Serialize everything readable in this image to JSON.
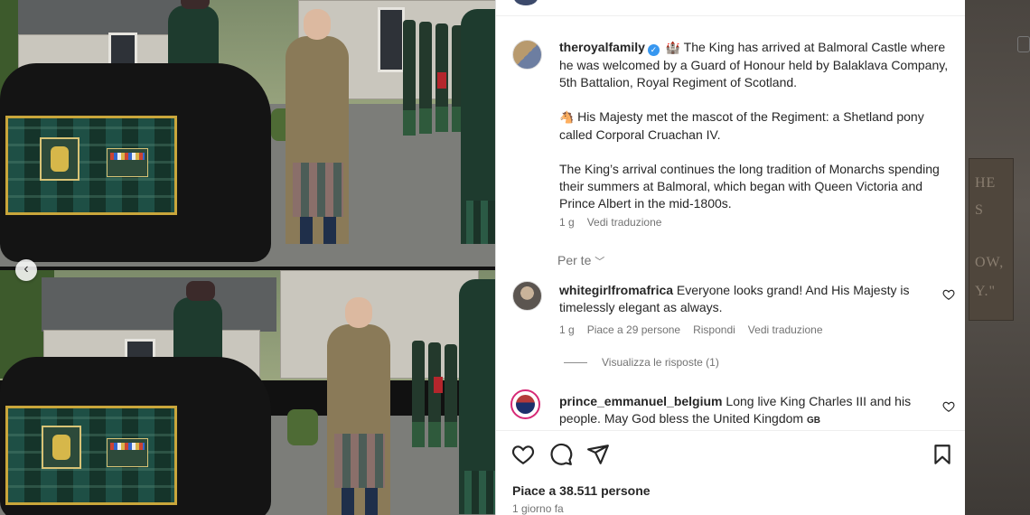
{
  "post": {
    "author": "theroyalfamily",
    "caption_p1": "The King has arrived at Balmoral Castle where he was welcomed by a Guard of Honour held by Balaklava Company, 5th Battalion, Royal Regiment of Scotland.",
    "caption_p2": "His Majesty met the mascot of the Regiment: a Shetland pony called Corporal Cruachan IV.",
    "caption_p3": "The King’s arrival continues the long tradition of Monarchs spending their summers at Balmoral, which began with Queen Victoria and Prince Albert in the mid-1800s.",
    "emoji1": "🏰",
    "emoji2": "🐴",
    "age": "1 g",
    "see_translation": "Vedi traduzione",
    "for_you": "Per te",
    "likes": "Piace a 38.511 persone",
    "time_ago": "1 giorno fa"
  },
  "comments": [
    {
      "username": "whitegirlfromafrica",
      "text": "Everyone looks grand! And His Majesty is timelessly elegant as always.",
      "age": "1 g",
      "likes": "Piace a 29 persone",
      "reply": "Rispondi",
      "translate": "Vedi traduzione",
      "view_replies": "Visualizza le risposte (1)"
    },
    {
      "username": "prince_emmanuel_belgium",
      "text": "Long live King Charles III and his people. May God bless the United Kingdom",
      "flag": "GB"
    }
  ],
  "icons": {
    "like": "heart-icon",
    "comment": "comment-icon",
    "share": "share-icon",
    "save": "bookmark-icon",
    "carousel": "chevron-left-icon",
    "verified": "verified-badge-icon"
  },
  "background_text": [
    "HE",
    "S",
    "OW,",
    "Y.\""
  ],
  "colors": {
    "verified": "#3797f0",
    "text": "#262626",
    "muted": "#737373"
  }
}
